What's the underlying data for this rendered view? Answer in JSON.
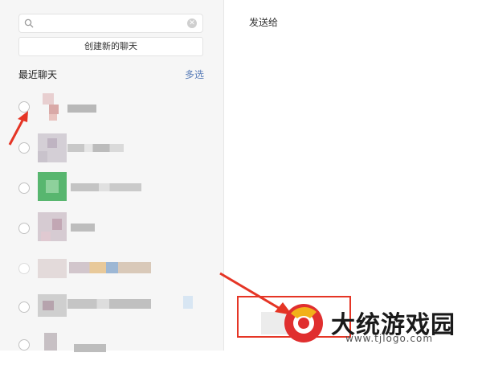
{
  "search": {
    "value": "",
    "placeholder": ""
  },
  "sidebar": {
    "create_chat_label": "创建新的聊天",
    "recent_title": "最近聊天",
    "multi_select_label": "多选",
    "chats": [
      {
        "name": ""
      },
      {
        "name": ""
      },
      {
        "name": ""
      },
      {
        "name": ""
      },
      {
        "name": ""
      },
      {
        "name": ""
      },
      {
        "name": ""
      }
    ]
  },
  "main": {
    "send_to_label": "发送给"
  },
  "watermark": {
    "brand": "大统游戏园",
    "url": "www.tjlogo.com"
  },
  "icons": {
    "search": "search-icon",
    "clear": "clear-icon",
    "logo": "watermark-logo-icon"
  },
  "colors": {
    "accent_link": "#5a7db8",
    "annotation_red": "#e53525",
    "panel_bg": "#f6f6f6"
  }
}
